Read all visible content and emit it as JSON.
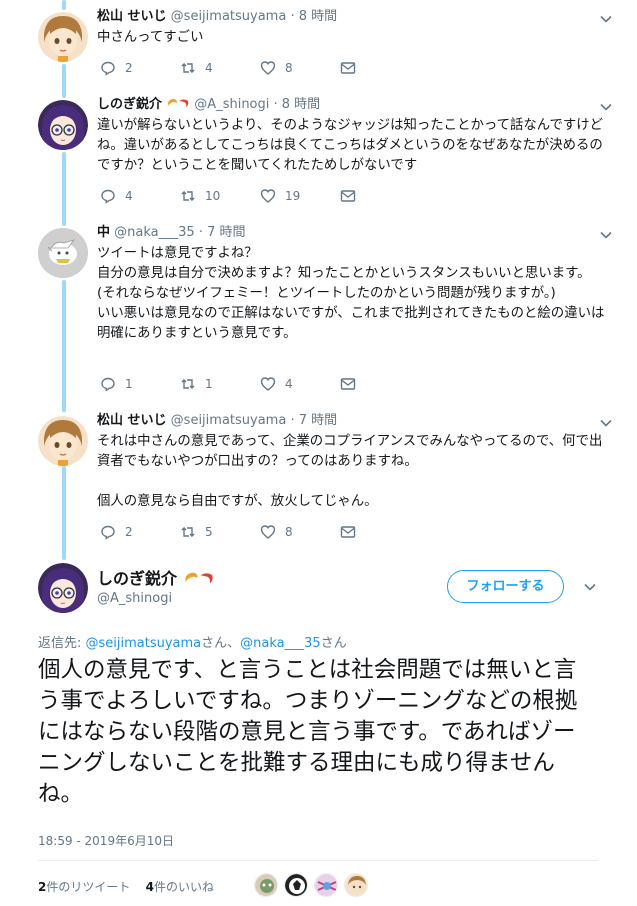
{
  "colors": {
    "accent": "#1da1f2",
    "thread_line": "#9fd8f9",
    "secondary_text": "#657786"
  },
  "tweets": [
    {
      "name": "松山 せいじ",
      "handle": "@seijimatsuyama",
      "time": "· 8 時間",
      "lines": [
        "中さんってすごい"
      ],
      "replies": "2",
      "retweets": "4",
      "likes": "8"
    },
    {
      "name": "しのぎ鋭介",
      "handle": "@A_shinogi",
      "time": "· 8 時間",
      "lines": [
        "違いが解らないというより、そのようなジャッジは知ったことかって話なんですけどね。違いがあるとしてこっちは良くてこっちはダメというのをなぜあなたが決めるのですか？ということを聞いてくれたためしがないです"
      ],
      "replies": "4",
      "retweets": "10",
      "likes": "19"
    },
    {
      "name": "中",
      "handle": "@naka___35",
      "time": "· 7 時間",
      "lines": [
        "ツイートは意見ですよね？",
        "自分の意見は自分で決めますよ？知ったことかというスタンスもいいと思います。(それならなぜツイフェミー！とツイートしたのかという問題が残りますが。)",
        "いい悪いは意見なので正解はないですが、これまで批判されてきたものと絵の違いは明確にありますという意見です。"
      ],
      "replies": "1",
      "retweets": "1",
      "likes": "4"
    },
    {
      "name": "松山 せいじ",
      "handle": "@seijimatsuyama",
      "time": "· 7 時間",
      "lines": [
        "それは中さんの意見であって、企業のコプライアンスでみんなやってるので、何で出資者でもないやつが口出すの？ってのはありますね。",
        "",
        "個人の意見なら自由ですが、放火してじゃん。"
      ],
      "replies": "2",
      "retweets": "5",
      "likes": "8"
    }
  ],
  "main": {
    "name": "しのぎ鋭介",
    "handle": "@A_shinogi",
    "follow_label": "フォローする",
    "reply_prefix": "返信先: ",
    "reply_user1": "@seijimatsuyama",
    "reply_san1": "さん、",
    "reply_user2": "@naka___35",
    "reply_san2": "さん",
    "text": "個人の意見です、と言うことは社会問題では無いと言う事でよろしいですね。つまりゾーニングなどの根拠にはならない段階の意見と言う事です。であればゾーニングしないことを批難する理由にも成り得ませんね。",
    "timestamp": "18:59 - 2019年6月10日",
    "retweet_count": "2",
    "retweet_label": "件のリツイート",
    "like_count": "4",
    "like_label": "件のいいね"
  },
  "icons": [
    "reply-icon",
    "retweet-icon",
    "like-icon",
    "message-icon",
    "chevron-down-icon"
  ]
}
